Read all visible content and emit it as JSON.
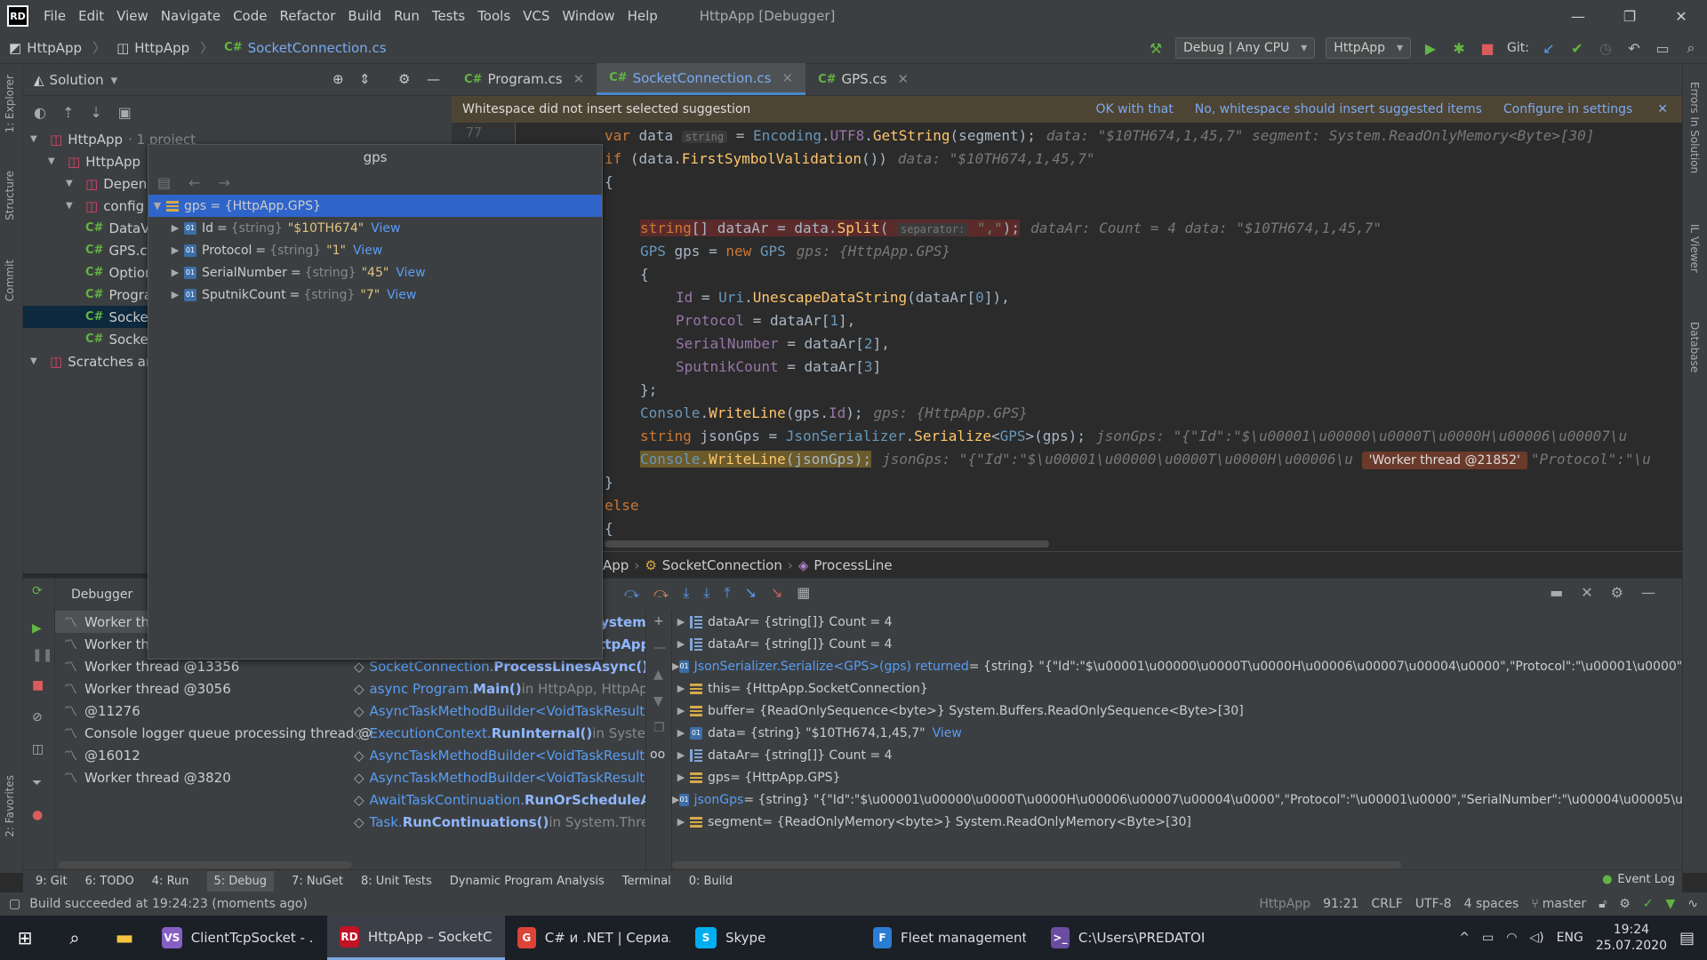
{
  "titlebar": {
    "logo": "RD",
    "menu": [
      "File",
      "Edit",
      "View",
      "Navigate",
      "Code",
      "Refactor",
      "Build",
      "Run",
      "Tests",
      "Tools",
      "VCS",
      "Window",
      "Help"
    ],
    "title": "HttpApp [Debugger]"
  },
  "navbar": {
    "crumbs": [
      "HttpApp",
      "HttpApp",
      "SocketConnection.cs"
    ],
    "config": "Debug | Any CPU",
    "project": "HttpApp",
    "git_label": "Git:"
  },
  "solution": {
    "header": "Solution",
    "rows": [
      {
        "label": "HttpApp",
        "suffix": "· 1 project",
        "indent": 0
      },
      {
        "label": "HttpApp",
        "suffix": "",
        "indent": 1
      },
      {
        "label": "Depen",
        "suffix": "",
        "indent": 2
      },
      {
        "label": "config",
        "suffix": "",
        "indent": 2
      },
      {
        "label": "DataV",
        "suffix": "",
        "indent": 2,
        "cs": true
      },
      {
        "label": "GPS.cs",
        "suffix": "",
        "indent": 2,
        "cs": true
      },
      {
        "label": "Option",
        "suffix": "",
        "indent": 2,
        "cs": true
      },
      {
        "label": "Progra",
        "suffix": "",
        "indent": 2,
        "cs": true
      },
      {
        "label": "Socket",
        "suffix": "",
        "indent": 2,
        "cs": true,
        "sel": true
      },
      {
        "label": "Socket",
        "suffix": "",
        "indent": 2,
        "cs": true
      },
      {
        "label": "Scratches and",
        "suffix": "",
        "indent": 0
      }
    ]
  },
  "popup": {
    "title": "gps",
    "root": "gps = {HttpApp.GPS}",
    "fields": [
      {
        "name": "Id",
        "type": "{string}",
        "value": "\"$10TH674\"",
        "link": "View"
      },
      {
        "name": "Protocol",
        "type": "{string}",
        "value": "\"1\"",
        "link": "View"
      },
      {
        "name": "SerialNumber",
        "type": "{string}",
        "value": "\"45\"",
        "link": "View"
      },
      {
        "name": "SputnikCount",
        "type": "{string}",
        "value": "\"7\"",
        "link": "View"
      }
    ]
  },
  "tabs": [
    {
      "label": "Program.cs",
      "active": false
    },
    {
      "label": "SocketConnection.cs",
      "active": true
    },
    {
      "label": "GPS.cs",
      "active": false
    }
  ],
  "notice": {
    "text": "Whitespace did not insert selected suggestion",
    "ok": "OK with that",
    "no": "No, whitespace should insert suggested items",
    "cfg": "Configure in settings"
  },
  "editor": {
    "line_no": "77",
    "l1_hint": "data: \"$10TH674,1,45,7\"  segment: System.ReadOnlyMemory<Byte>[30]",
    "l2_hint": "data: \"$10TH674,1,45,7\"",
    "l3_hint": "dataAr: Count = 4  data: \"$10TH674,1,45,7\"",
    "l4_hint": "gps: {HttpApp.GPS}",
    "l5_hint": "gps: {HttpApp.GPS}",
    "l6_hint": "jsonGps: \"{\"Id\":\"$\\u00001\\u00000\\u0000T\\u0000H\\u00006\\u00007\\u",
    "l7_hint": "jsonGps: \"{\"Id\":\"$\\u00001\\u00000\\u0000T\\u0000H\\u00006\\u",
    "worker_badge": "'Worker thread @21852'",
    "l7_tail": "\"Protocol\":\"\\u",
    "separator_hint": "separator:"
  },
  "breadbar": [
    "App",
    "SocketConnection",
    "ProcessLine"
  ],
  "debugger": {
    "title": "Debugger",
    "threads": [
      "Worker thr",
      "Worker thr",
      "Worker thread @13356",
      "Worker thread @3056",
      "@11276",
      "Console logger queue processing thread @",
      "@16012",
      "Worker thread @3820"
    ],
    "frames": [
      {
        "pre": "AsyncMethodBuilderCore.",
        "bold": "Start<System.",
        "post": ""
      },
      {
        "pre": "AsyncTaskMethodBuilder.",
        "bold": "Start<HttpApp.S",
        "post": ""
      },
      {
        "pre": "SocketConnection.",
        "bold": "ProcessLinesAsync()",
        "post": " in"
      },
      {
        "pre": "async Program.",
        "bold": "Main()",
        "post": " in HttpApp, HttpAp"
      },
      {
        "pre": "AsyncTaskMethodBuilder<VoidTaskResult>",
        "bold": "",
        "post": ""
      },
      {
        "pre": "ExecutionContext.",
        "bold": "RunInternal()",
        "post": " in System."
      },
      {
        "pre": "AsyncTaskMethodBuilder<VoidTaskResult>",
        "bold": "",
        "post": ""
      },
      {
        "pre": "AsyncTaskMethodBuilder<VoidTaskResult>",
        "bold": "",
        "post": ""
      },
      {
        "pre": "AwaitTaskContinuation.",
        "bold": "RunOrScheduleAct",
        "post": ""
      },
      {
        "pre": "Task.",
        "bold": "RunContinuations()",
        "post": " in System.Thread"
      }
    ],
    "vars": [
      {
        "icon": "list",
        "name": "dataAr",
        "rest": " = {string[]} Count = 4",
        "link": ""
      },
      {
        "icon": "list",
        "name": "dataAr",
        "rest": " = {string[]} Count = 4",
        "link": ""
      },
      {
        "icon": "field",
        "name": "JsonSerializer.Serialize<GPS>(gps) returned",
        "rest": " = {string} \"{\"Id\":\"$\\u00001\\u00000\\u0000T\\u0000H\\u00006\\u00007\\u00004\\u0000\",\"Protocol\":\"\\u00001\\u0000\",\"Seria",
        "link": "View",
        "blue": true
      },
      {
        "icon": "obj",
        "name": "this",
        "rest": " = {HttpApp.SocketConnection}",
        "link": ""
      },
      {
        "icon": "obj",
        "name": "buffer",
        "rest": " = {ReadOnlySequence<byte>} System.Buffers.ReadOnlySequence<Byte>[30]",
        "link": ""
      },
      {
        "icon": "field",
        "name": "data",
        "rest": " = {string} \"$10TH674,1,45,7\"",
        "link": "View"
      },
      {
        "icon": "list",
        "name": "dataAr",
        "rest": " = {string[]} Count = 4",
        "link": ""
      },
      {
        "icon": "obj",
        "name": "gps",
        "rest": " = {HttpApp.GPS}",
        "link": ""
      },
      {
        "icon": "field",
        "name": "jsonGps",
        "rest": " = {string} \"{\"Id\":\"$\\u00001\\u00000\\u0000T\\u0000H\\u00006\\u00007\\u00004\\u0000\",\"Protocol\":\"\\u00001\\u0000\",\"SerialNumber\":\"\\u00004\\u00005\\u0000\"",
        "link": "View",
        "blue": true
      },
      {
        "icon": "obj",
        "name": "segment",
        "rest": " = {ReadOnlyMemory<byte>} System.ReadOnlyMemory<Byte>[30]",
        "link": ""
      }
    ]
  },
  "bottomtabs": [
    "9: Git",
    "6: TODO",
    "4: Run",
    "5: Debug",
    "7: NuGet",
    "8: Unit Tests",
    "Dynamic Program Analysis",
    "Terminal",
    "0: Build"
  ],
  "event_log": "Event Log",
  "status": {
    "left": "Build succeeded at 19:24:23 (moments ago)",
    "project": "HttpApp",
    "pos": "91:21",
    "eol": "CRLF",
    "enc": "UTF-8",
    "indent": "4 spaces",
    "branch": "master"
  },
  "taskbar": {
    "apps": [
      {
        "label": "ClientTcpSocket - ...",
        "color": "#865fc5",
        "icon": "VS"
      },
      {
        "label": "HttpApp – SocketC...",
        "color": "#c21325",
        "icon": "RD",
        "active": true
      },
      {
        "label": "C# и .NET | Сериал...",
        "color": "#db4437",
        "icon": "G"
      },
      {
        "label": "Skype",
        "color": "#00aff0",
        "icon": "S"
      },
      {
        "label": "Fleet management ...",
        "color": "#2b7cd3",
        "icon": "F"
      },
      {
        "label": "C:\\Users\\PREDATOR...",
        "color": "#6a4ca0",
        "icon": ">_"
      }
    ],
    "lang": "ENG",
    "time": "19:24",
    "date": "25.07.2020"
  }
}
